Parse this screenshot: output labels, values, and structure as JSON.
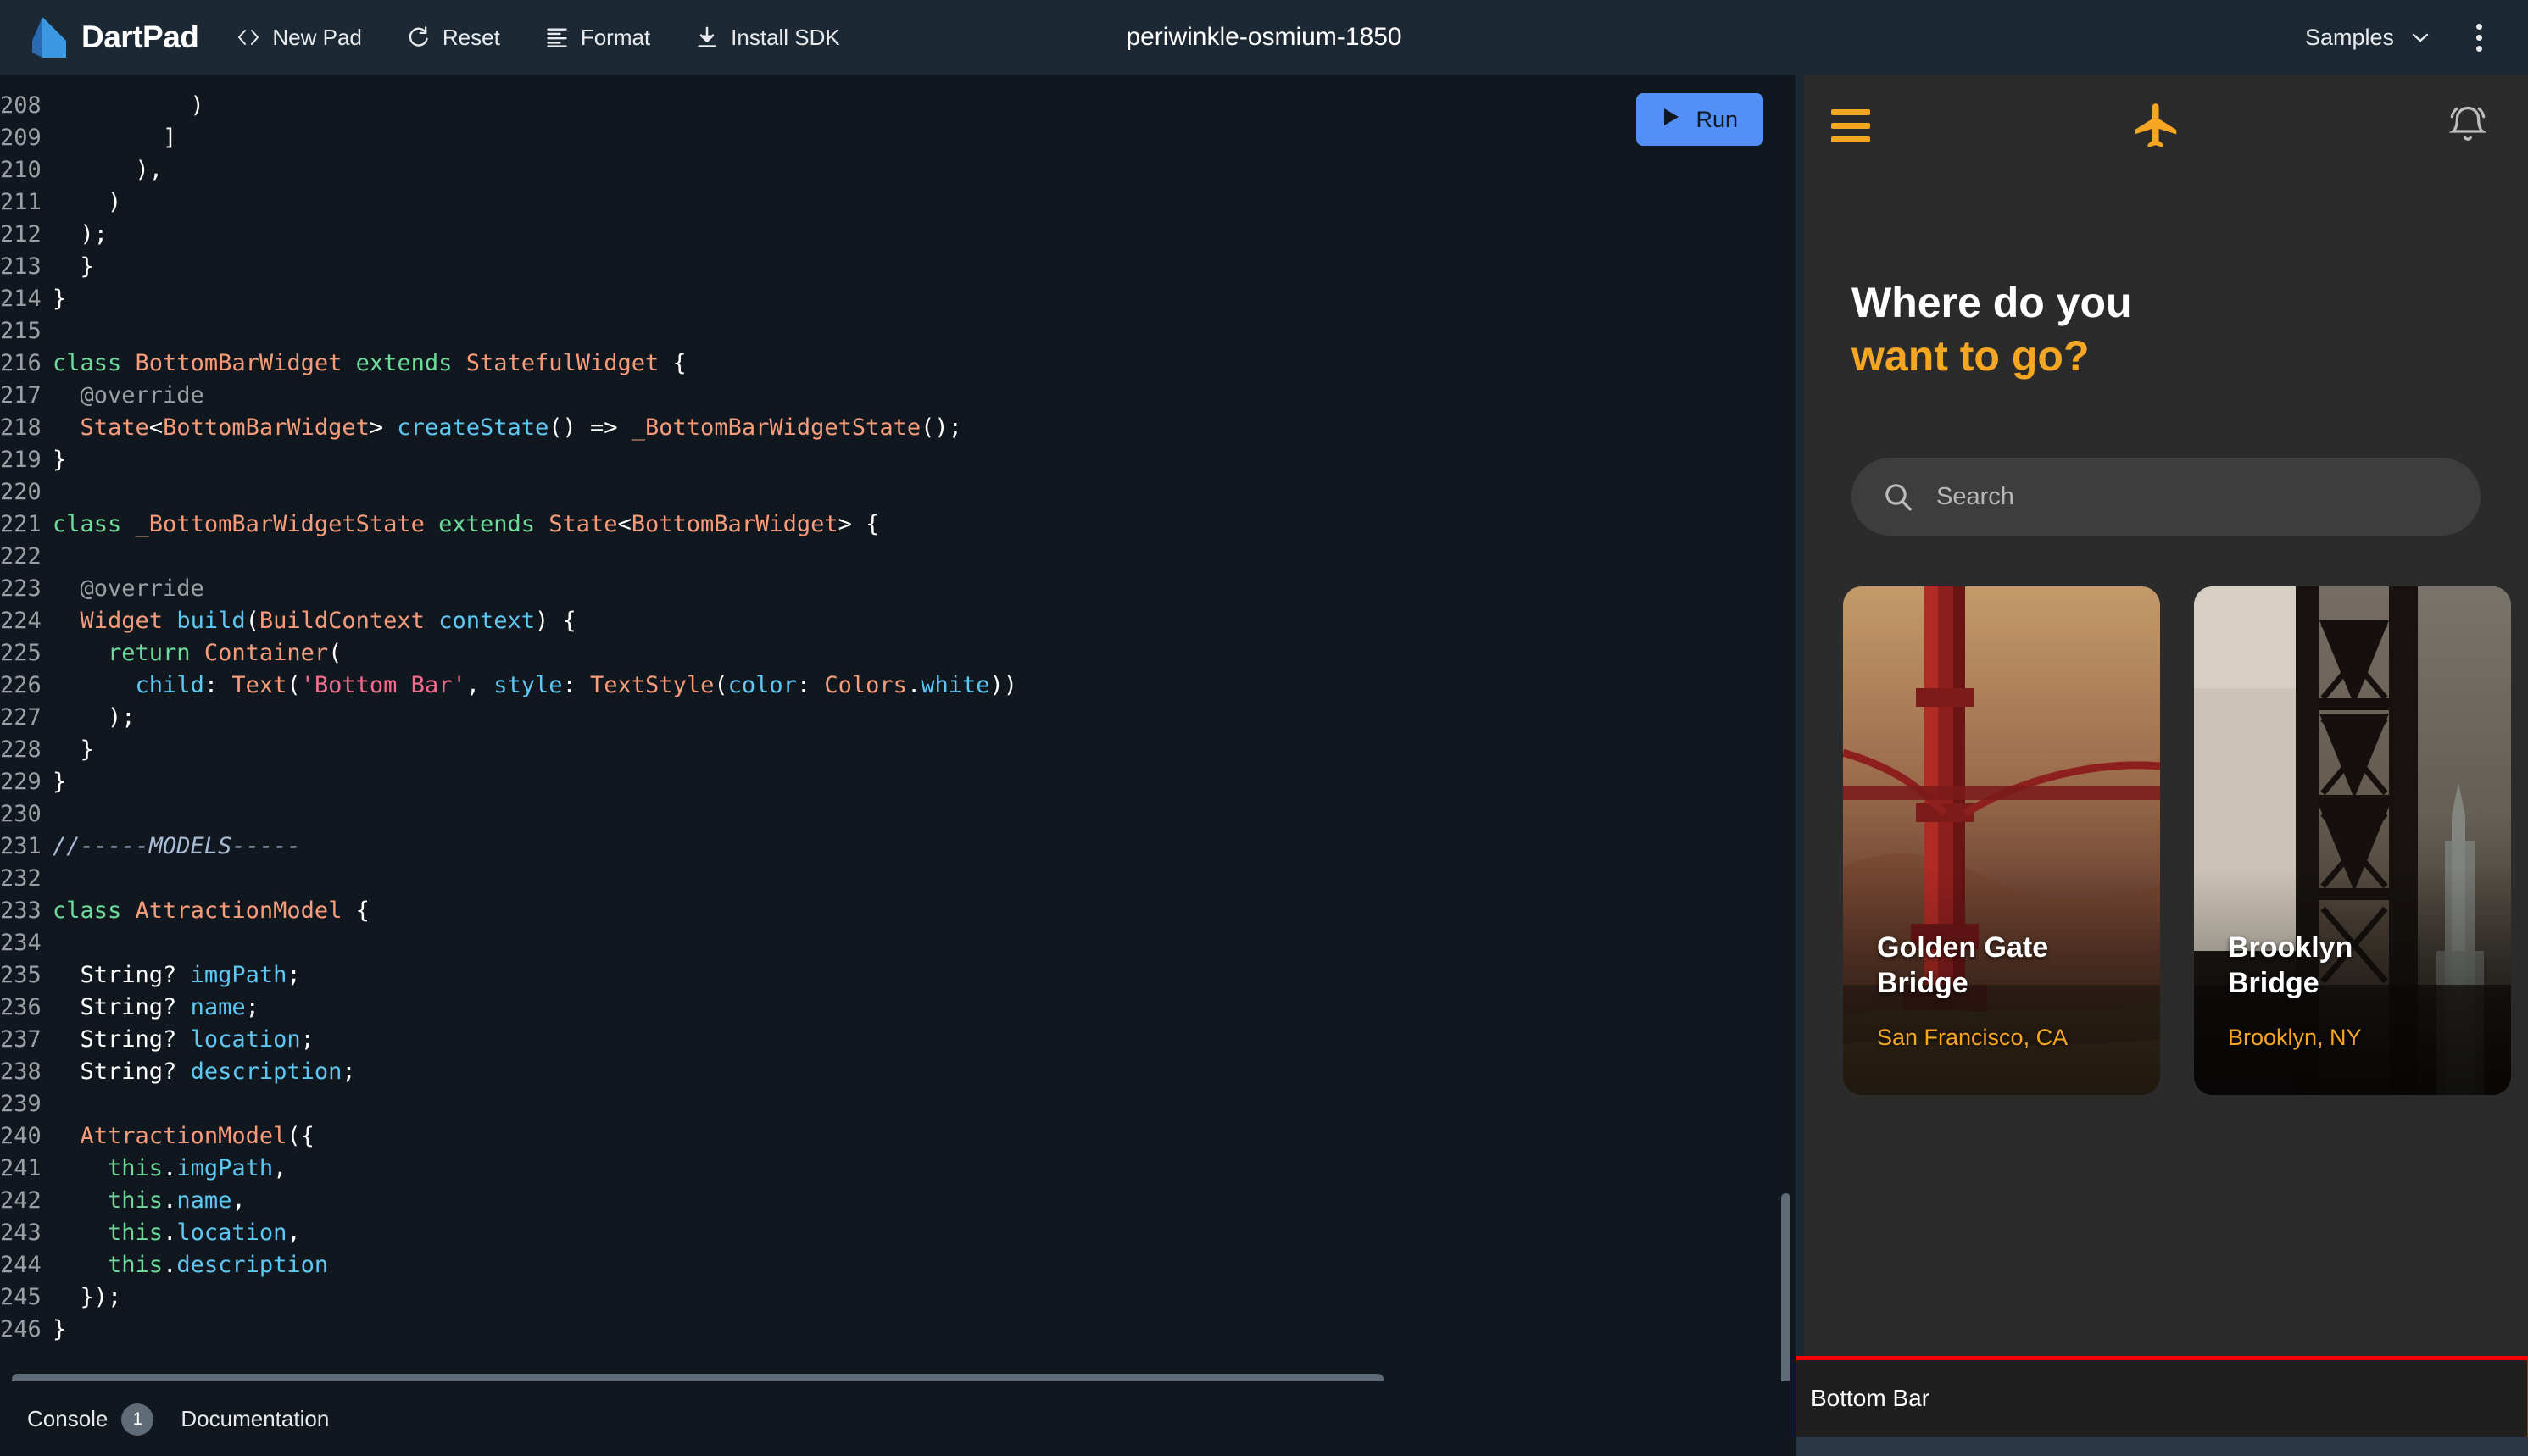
{
  "toolbar": {
    "brand": "DartPad",
    "logo_icon": "dart-logo-icon",
    "buttons": [
      {
        "label": "New Pad",
        "icon": "code-brackets-icon"
      },
      {
        "label": "Reset",
        "icon": "reset-refresh-icon"
      },
      {
        "label": "Format",
        "icon": "format-lines-icon"
      },
      {
        "label": "Install SDK",
        "icon": "download-icon"
      }
    ],
    "doc_title": "periwinkle-osmium-1850",
    "samples_label": "Samples",
    "samples_chevron_icon": "chevron-down-icon",
    "kebab_icon": "more-vert-icon"
  },
  "editor": {
    "run_button": {
      "label": "Run",
      "icon": "play-triangle-icon",
      "color": "#5290f7"
    },
    "first_line_number": 208,
    "lines": [
      {
        "n": 208,
        "tokens": [
          {
            "t": "          )",
            "c": "pn"
          }
        ]
      },
      {
        "n": 209,
        "tokens": [
          {
            "t": "        ]",
            "c": "pn"
          }
        ]
      },
      {
        "n": 210,
        "tokens": [
          {
            "t": "      ),",
            "c": "pn"
          }
        ]
      },
      {
        "n": 211,
        "tokens": [
          {
            "t": "    )",
            "c": "pn"
          }
        ]
      },
      {
        "n": 212,
        "tokens": [
          {
            "t": "  );",
            "c": "pn"
          }
        ]
      },
      {
        "n": 213,
        "tokens": [
          {
            "t": "  }",
            "c": "pn"
          }
        ]
      },
      {
        "n": 214,
        "tokens": [
          {
            "t": "}",
            "c": "pn"
          }
        ]
      },
      {
        "n": 215,
        "tokens": []
      },
      {
        "n": 216,
        "tokens": [
          {
            "t": "class ",
            "c": "kw"
          },
          {
            "t": "BottomBarWidget ",
            "c": "ty"
          },
          {
            "t": "extends ",
            "c": "kw"
          },
          {
            "t": "StatefulWidget",
            "c": "ty"
          },
          {
            "t": " {",
            "c": "pn"
          }
        ]
      },
      {
        "n": 217,
        "tokens": [
          {
            "t": "  @override",
            "c": "cm"
          }
        ]
      },
      {
        "n": 218,
        "tokens": [
          {
            "t": "  ",
            "c": "pn"
          },
          {
            "t": "State",
            "c": "ty"
          },
          {
            "t": "<",
            "c": "pn"
          },
          {
            "t": "BottomBarWidget",
            "c": "ty"
          },
          {
            "t": "> ",
            "c": "pn"
          },
          {
            "t": "createState",
            "c": "fn"
          },
          {
            "t": "() => ",
            "c": "pn"
          },
          {
            "t": "_BottomBarWidgetState",
            "c": "ty"
          },
          {
            "t": "();",
            "c": "pn"
          }
        ]
      },
      {
        "n": 219,
        "tokens": [
          {
            "t": "}",
            "c": "pn"
          }
        ]
      },
      {
        "n": 220,
        "tokens": []
      },
      {
        "n": 221,
        "tokens": [
          {
            "t": "class ",
            "c": "kw"
          },
          {
            "t": "_BottomBarWidgetState ",
            "c": "ty"
          },
          {
            "t": "extends ",
            "c": "kw"
          },
          {
            "t": "State",
            "c": "ty"
          },
          {
            "t": "<",
            "c": "pn"
          },
          {
            "t": "BottomBarWidget",
            "c": "ty"
          },
          {
            "t": "> {",
            "c": "pn"
          }
        ]
      },
      {
        "n": 222,
        "tokens": []
      },
      {
        "n": 223,
        "tokens": [
          {
            "t": "  @override",
            "c": "cm"
          }
        ]
      },
      {
        "n": 224,
        "tokens": [
          {
            "t": "  ",
            "c": "pn"
          },
          {
            "t": "Widget ",
            "c": "ty"
          },
          {
            "t": "build",
            "c": "fn"
          },
          {
            "t": "(",
            "c": "pn"
          },
          {
            "t": "BuildContext ",
            "c": "ty"
          },
          {
            "t": "context",
            "c": "fn"
          },
          {
            "t": ") {",
            "c": "pn"
          }
        ]
      },
      {
        "n": 225,
        "tokens": [
          {
            "t": "    ",
            "c": "pn"
          },
          {
            "t": "return ",
            "c": "kw"
          },
          {
            "t": "Container",
            "c": "ty"
          },
          {
            "t": "(",
            "c": "pn"
          }
        ]
      },
      {
        "n": 226,
        "tokens": [
          {
            "t": "      ",
            "c": "pn"
          },
          {
            "t": "child",
            "c": "fn"
          },
          {
            "t": ": ",
            "c": "pn"
          },
          {
            "t": "Text",
            "c": "ty"
          },
          {
            "t": "(",
            "c": "pn"
          },
          {
            "t": "'Bottom Bar'",
            "c": "st"
          },
          {
            "t": ", ",
            "c": "pn"
          },
          {
            "t": "style",
            "c": "fn"
          },
          {
            "t": ": ",
            "c": "pn"
          },
          {
            "t": "TextStyle",
            "c": "ty"
          },
          {
            "t": "(",
            "c": "pn"
          },
          {
            "t": "color",
            "c": "fn"
          },
          {
            "t": ": ",
            "c": "pn"
          },
          {
            "t": "Colors",
            "c": "ty"
          },
          {
            "t": ".",
            "c": "pn"
          },
          {
            "t": "white",
            "c": "fn"
          },
          {
            "t": "))",
            "c": "pn"
          }
        ]
      },
      {
        "n": 227,
        "tokens": [
          {
            "t": "    );",
            "c": "pn"
          }
        ]
      },
      {
        "n": 228,
        "tokens": [
          {
            "t": "  }",
            "c": "pn"
          }
        ]
      },
      {
        "n": 229,
        "tokens": [
          {
            "t": "}",
            "c": "pn"
          }
        ]
      },
      {
        "n": 230,
        "tokens": []
      },
      {
        "n": 231,
        "tokens": [
          {
            "t": "//-----MODELS-----",
            "c": "cm2"
          }
        ]
      },
      {
        "n": 232,
        "tokens": []
      },
      {
        "n": 233,
        "tokens": [
          {
            "t": "class ",
            "c": "kw"
          },
          {
            "t": "AttractionModel",
            "c": "ty"
          },
          {
            "t": " {",
            "c": "pn"
          }
        ]
      },
      {
        "n": 234,
        "tokens": []
      },
      {
        "n": 235,
        "tokens": [
          {
            "t": "  String? ",
            "c": "pn"
          },
          {
            "t": "imgPath",
            "c": "fn"
          },
          {
            "t": ";",
            "c": "pn"
          }
        ]
      },
      {
        "n": 236,
        "tokens": [
          {
            "t": "  String? ",
            "c": "pn"
          },
          {
            "t": "name",
            "c": "fn"
          },
          {
            "t": ";",
            "c": "pn"
          }
        ]
      },
      {
        "n": 237,
        "tokens": [
          {
            "t": "  String? ",
            "c": "pn"
          },
          {
            "t": "location",
            "c": "fn"
          },
          {
            "t": ";",
            "c": "pn"
          }
        ]
      },
      {
        "n": 238,
        "tokens": [
          {
            "t": "  String? ",
            "c": "pn"
          },
          {
            "t": "description",
            "c": "fn"
          },
          {
            "t": ";",
            "c": "pn"
          }
        ]
      },
      {
        "n": 239,
        "tokens": []
      },
      {
        "n": 240,
        "tokens": [
          {
            "t": "  ",
            "c": "pn"
          },
          {
            "t": "AttractionModel",
            "c": "ty"
          },
          {
            "t": "({",
            "c": "pn"
          }
        ]
      },
      {
        "n": 241,
        "tokens": [
          {
            "t": "    ",
            "c": "pn"
          },
          {
            "t": "this",
            "c": "kw"
          },
          {
            "t": ".",
            "c": "pn"
          },
          {
            "t": "imgPath",
            "c": "fn"
          },
          {
            "t": ",",
            "c": "pn"
          }
        ]
      },
      {
        "n": 242,
        "tokens": [
          {
            "t": "    ",
            "c": "pn"
          },
          {
            "t": "this",
            "c": "kw"
          },
          {
            "t": ".",
            "c": "pn"
          },
          {
            "t": "name",
            "c": "fn"
          },
          {
            "t": ",",
            "c": "pn"
          }
        ]
      },
      {
        "n": 243,
        "tokens": [
          {
            "t": "    ",
            "c": "pn"
          },
          {
            "t": "this",
            "c": "kw"
          },
          {
            "t": ".",
            "c": "pn"
          },
          {
            "t": "location",
            "c": "fn"
          },
          {
            "t": ",",
            "c": "pn"
          }
        ]
      },
      {
        "n": 244,
        "tokens": [
          {
            "t": "    ",
            "c": "pn"
          },
          {
            "t": "this",
            "c": "kw"
          },
          {
            "t": ".",
            "c": "pn"
          },
          {
            "t": "description",
            "c": "fn"
          }
        ]
      },
      {
        "n": 245,
        "tokens": [
          {
            "t": "  });",
            "c": "pn"
          }
        ]
      },
      {
        "n": 246,
        "tokens": [
          {
            "t": "}",
            "c": "pn"
          }
        ]
      }
    ],
    "footer": {
      "console_label": "Console",
      "console_count": "1",
      "documentation_label": "Documentation"
    }
  },
  "preview": {
    "app_bar": {
      "menu_icon": "hamburger-menu-icon",
      "logo_icon": "airplane-icon",
      "notification_icon": "bell-icon",
      "accent": "#f5a623"
    },
    "headline_line1": "Where do you",
    "headline_line2": "want to go?",
    "search": {
      "placeholder": "Search",
      "icon": "search-icon"
    },
    "cards": [
      {
        "name": "Golden Gate\nBridge",
        "name_l1": "Golden Gate",
        "name_l2": "Bridge",
        "location": "San Francisco, CA"
      },
      {
        "name": "Brooklyn\nBridge",
        "name_l1": "Brooklyn",
        "name_l2": "Bridge",
        "location": "Brooklyn, NY"
      }
    ],
    "bottom_bar_label": "Bottom Bar",
    "debug_outline_color": "#ff0000"
  }
}
